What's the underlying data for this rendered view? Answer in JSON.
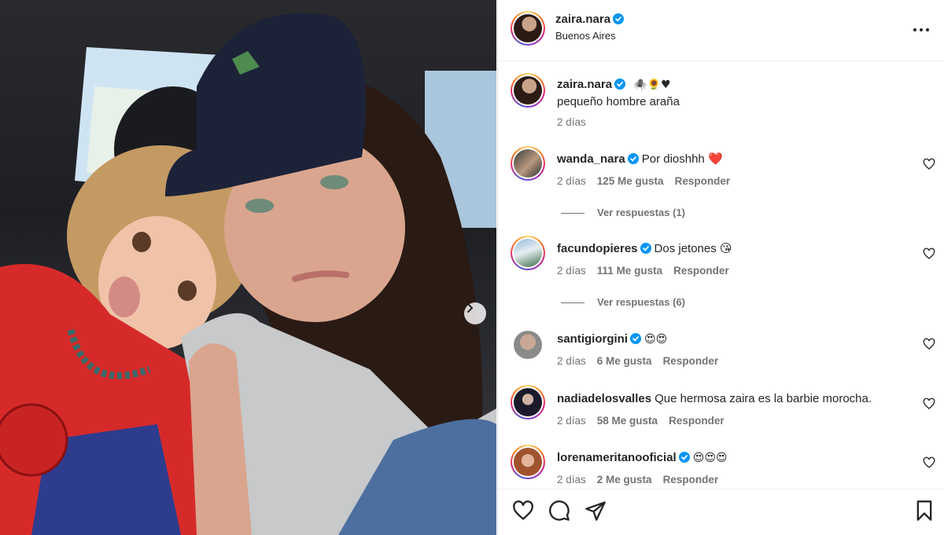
{
  "post": {
    "author": "zaira.nara",
    "location": "Buenos Aires",
    "caption_emojis": "🕷️🌻♥",
    "caption": "pequeño hombre araña",
    "caption_time": "2 días"
  },
  "comments": [
    {
      "user": "wanda_nara",
      "verified": true,
      "text": "Por dioshhh ❤️",
      "time": "2 días",
      "likes": "125 Me gusta",
      "reply": "Responder",
      "view_replies": "Ver respuestas (1)"
    },
    {
      "user": "facundopieres",
      "verified": true,
      "text": "Dos jetones 😘",
      "time": "2 días",
      "likes": "111 Me gusta",
      "reply": "Responder",
      "view_replies": "Ver respuestas (6)"
    },
    {
      "user": "santigiorgini",
      "verified": true,
      "text": "😍😍",
      "time": "2 días",
      "likes": "6 Me gusta",
      "reply": "Responder"
    },
    {
      "user": "nadiadelosvalles",
      "verified": false,
      "text": "Que hermosa zaira es la barbie morocha.",
      "time": "2 días",
      "likes": "58 Me gusta",
      "reply": "Responder"
    },
    {
      "user": "lorenameritanooficial",
      "verified": true,
      "text": "😍😍😍",
      "time": "2 días",
      "likes": "2 Me gusta",
      "reply": "Responder"
    }
  ],
  "icons": {
    "more": "more-options-icon",
    "verified": "verified-badge-icon",
    "like": "heart-icon",
    "comment": "comment-icon",
    "share": "share-icon",
    "save": "bookmark-icon",
    "next": "chevron-right-icon"
  },
  "colors": {
    "verified": "#0095f6",
    "muted": "#737373",
    "text": "#262626"
  }
}
